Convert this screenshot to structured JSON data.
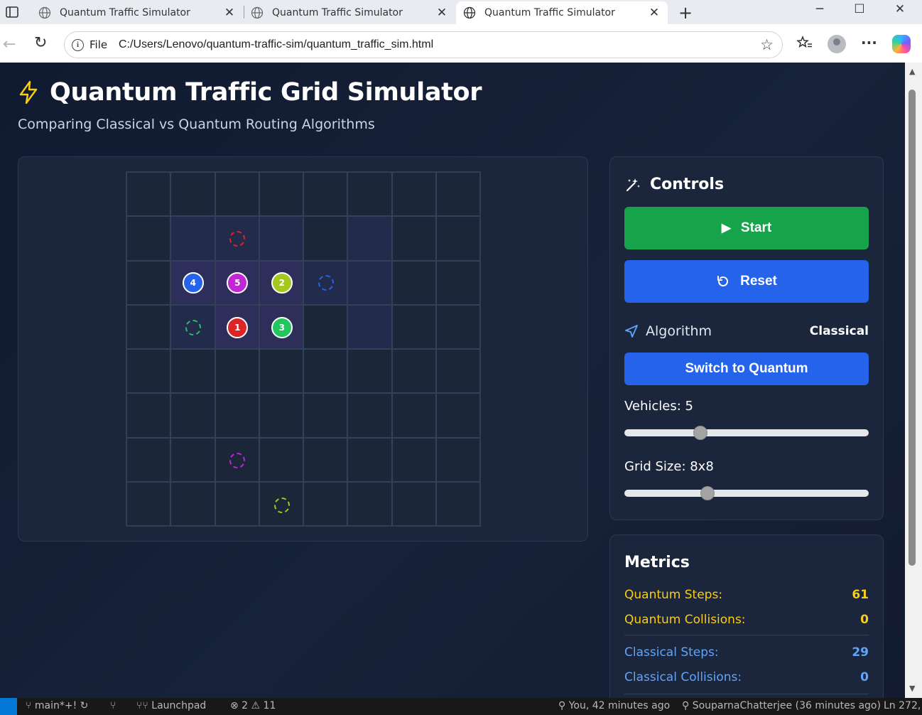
{
  "browser": {
    "tabs": [
      {
        "title": "Quantum Traffic Simulator",
        "active": false
      },
      {
        "title": "Quantum Traffic Simulator",
        "active": false
      },
      {
        "title": "Quantum Traffic Simulator",
        "active": true
      }
    ],
    "new_tab": "+",
    "window_controls": {
      "minimize": "─",
      "maximize": "☐",
      "close": "✕"
    },
    "address": {
      "scheme_label": "File",
      "url": "C:/Users/Lenovo/quantum-traffic-sim/quantum_traffic_sim.html"
    },
    "icons": [
      "back-icon",
      "reload-icon",
      "info-icon",
      "favorite-star-icon",
      "favorites-icon",
      "profile-icon",
      "more-icon",
      "copilot-icon"
    ]
  },
  "page": {
    "title": "Quantum Traffic Grid Simulator",
    "subtitle": "Comparing Classical vs Quantum Routing Algorithms",
    "accent": "#facc15"
  },
  "grid": {
    "rows": 8,
    "cols": 8,
    "highlighted_cells": [
      {
        "row": 1,
        "col": 1,
        "level": 1
      },
      {
        "row": 1,
        "col": 2,
        "level": 1
      },
      {
        "row": 1,
        "col": 3,
        "level": 1
      },
      {
        "row": 1,
        "col": 5,
        "level": 1
      },
      {
        "row": 2,
        "col": 1,
        "level": 2
      },
      {
        "row": 2,
        "col": 2,
        "level": 2
      },
      {
        "row": 2,
        "col": 3,
        "level": 2
      },
      {
        "row": 2,
        "col": 4,
        "level": 1
      },
      {
        "row": 2,
        "col": 5,
        "level": 1
      },
      {
        "row": 3,
        "col": 1,
        "level": 1
      },
      {
        "row": 3,
        "col": 2,
        "level": 2
      },
      {
        "row": 3,
        "col": 3,
        "level": 2
      },
      {
        "row": 3,
        "col": 5,
        "level": 1
      }
    ],
    "vehicles": [
      {
        "label": "1",
        "row": 3,
        "col": 2,
        "color": "#dc2626"
      },
      {
        "label": "2",
        "row": 2,
        "col": 3,
        "color": "#a3c81f"
      },
      {
        "label": "3",
        "row": 3,
        "col": 3,
        "color": "#22c55e"
      },
      {
        "label": "4",
        "row": 2,
        "col": 1,
        "color": "#2563eb"
      },
      {
        "label": "5",
        "row": 2,
        "col": 2,
        "color": "#c026d3"
      }
    ],
    "destinations": [
      {
        "row": 1,
        "col": 2,
        "color": "#dc2626"
      },
      {
        "row": 2,
        "col": 4,
        "color": "#2563eb"
      },
      {
        "row": 3,
        "col": 1,
        "color": "#22c55e"
      },
      {
        "row": 6,
        "col": 2,
        "color": "#c026d3"
      },
      {
        "row": 7,
        "col": 3,
        "color": "#a3c81f"
      }
    ]
  },
  "controls": {
    "heading": "Controls",
    "start_label": "Start",
    "reset_label": "Reset",
    "algorithm_label": "Algorithm",
    "algorithm_value": "Classical",
    "switch_label": "Switch to Quantum",
    "vehicles_label": "Vehicles: 5",
    "vehicles_slider_fraction": 0.31,
    "gridsize_label": "Grid Size: 8x8",
    "gridsize_slider_fraction": 0.34,
    "colors": {
      "start": "#16a34a",
      "primary": "#2563eb"
    }
  },
  "metrics": {
    "heading": "Metrics",
    "quantum_steps_label": "Quantum Steps:",
    "quantum_steps": "61",
    "quantum_collisions_label": "Quantum Collisions:",
    "quantum_collisions": "0",
    "classical_steps_label": "Classical Steps:",
    "classical_steps": "29",
    "classical_collisions_label": "Classical Collisions:",
    "classical_collisions": "0",
    "colors": {
      "quantum": "#facc15",
      "classical": "#60a5fa"
    }
  },
  "statusbar": {
    "branch": "main*+!",
    "launchpad": "Launchpad",
    "problems": "⊗ 2 ⚠ 11",
    "blame": "You, 42 minutes ago",
    "author": "SouparnaChatterjee (36 minutes ago)",
    "position": "Ln 272,"
  }
}
